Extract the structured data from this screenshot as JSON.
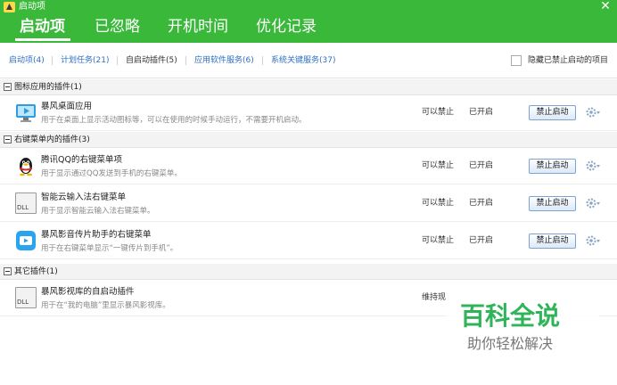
{
  "window": {
    "title": "启动项",
    "colors": {
      "header": "#3ab83a",
      "link": "#2c6fc5"
    }
  },
  "main_tabs": [
    {
      "label": "启动项",
      "active": true
    },
    {
      "label": "已忽略",
      "active": false
    },
    {
      "label": "开机时间",
      "active": false
    },
    {
      "label": "优化记录",
      "active": false
    }
  ],
  "sub_tabs": [
    {
      "label": "启动项(4)"
    },
    {
      "label": "计划任务(21)"
    },
    {
      "label": "自启动插件(5)"
    },
    {
      "label": "应用软件服务(6)"
    },
    {
      "label": "系统关键服务(37)"
    }
  ],
  "hide_disabled": {
    "label": "隐藏已禁止启动的项目",
    "checked": false
  },
  "groups": [
    {
      "label": "图标应用的插件(1)"
    },
    {
      "label": "右键菜单内的插件(3)"
    },
    {
      "label": "其它插件(1)"
    }
  ],
  "items": [
    {
      "title": "暴风桌面应用",
      "desc": "用于在桌面上显示活动图标等，可以在使用的时候手动运行，不需要开机启动。",
      "advice": "可以禁止",
      "status": "已开启",
      "action": "禁止启动",
      "icon": "storm-desktop-icon"
    },
    {
      "title": "腾讯QQ的右键菜单项",
      "desc": "用于显示通过QQ发送到手机的右键菜单。",
      "advice": "可以禁止",
      "status": "已开启",
      "action": "禁止启动",
      "icon": "qq-penguin-icon"
    },
    {
      "title": "智能云输入法右键菜单",
      "desc": "用于显示智能云输入法右键菜单。",
      "advice": "可以禁止",
      "status": "已开启",
      "action": "禁止启动",
      "icon": "dll-file-icon",
      "icon_text": "DLL"
    },
    {
      "title": "暴风影音传片助手的右键菜单",
      "desc": "用于在右键菜单显示“一键传片到手机”。",
      "advice": "可以禁止",
      "status": "已开启",
      "action": "禁止启动",
      "icon": "storm-transfer-icon"
    },
    {
      "title": "暴风影视库的自启动插件",
      "desc": "用于在“我的电脑”里显示暴风影视库。",
      "advice": "维持现",
      "icon": "dll-file-icon",
      "icon_text": "DLL"
    }
  ],
  "watermark": {
    "title": "百科全说",
    "subtitle": "助你轻松解决"
  }
}
